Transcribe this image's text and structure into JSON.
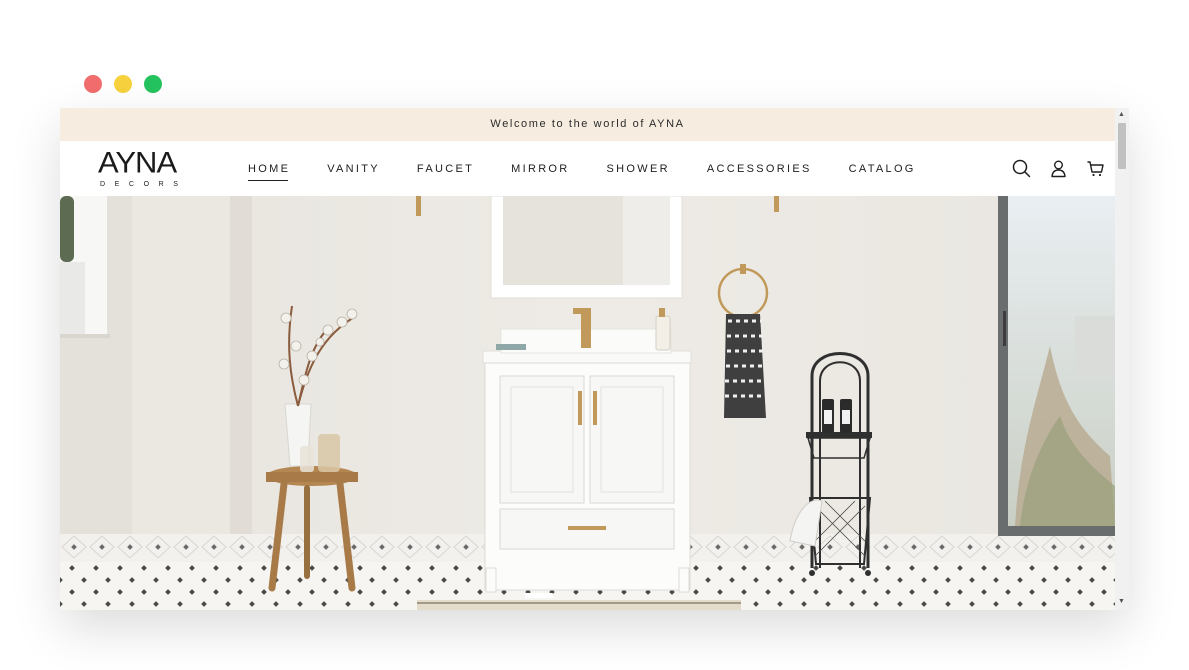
{
  "window_controls": [
    "close",
    "minimize",
    "maximize"
  ],
  "announcement": "Welcome to the world of AYNA",
  "brand": {
    "name": "AYNA",
    "subtitle": "DECORS"
  },
  "nav": [
    {
      "label": "HOME",
      "active": true
    },
    {
      "label": "VANITY"
    },
    {
      "label": "FAUCET"
    },
    {
      "label": "MIRROR"
    },
    {
      "label": "SHOWER"
    },
    {
      "label": "ACCESSORIES"
    },
    {
      "label": "CATALOG"
    }
  ],
  "header_icons": [
    "search-icon",
    "account-icon",
    "cart-icon"
  ],
  "colors": {
    "announcement_bg": "#f6ede0",
    "text": "#1e1e1e",
    "brass": "#c19a5b",
    "wall": "#ece9e3"
  }
}
